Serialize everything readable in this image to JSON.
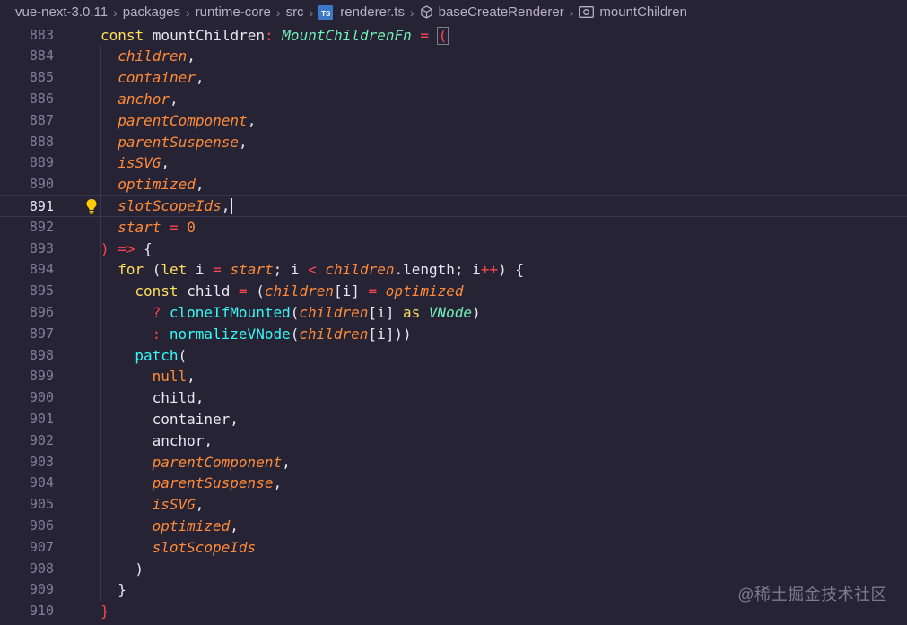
{
  "breadcrumb": {
    "items": [
      "vue-next-3.0.11",
      "packages",
      "runtime-core",
      "src",
      "renderer.ts",
      "baseCreateRenderer",
      "mountChildren"
    ],
    "ts_badge": "TS"
  },
  "colors": {
    "background": "#262335",
    "keyword": "#fede5d",
    "parameter": "#ff8b39",
    "type": "#72f1b8",
    "function": "#36f9f6",
    "plain": "#e8e6f0",
    "punct": "#fe4450",
    "line_number": "#837e9b"
  },
  "editor": {
    "current_line": 891,
    "lines": [
      {
        "n": "883",
        "indent": 0,
        "tokens": [
          [
            "const ",
            "kw"
          ],
          [
            "mountChildren",
            "var"
          ],
          [
            ": ",
            "op"
          ],
          [
            "MountChildrenFn",
            "type"
          ],
          [
            " = ",
            "op"
          ],
          [
            "(",
            "bracket"
          ]
        ]
      },
      {
        "n": "884",
        "indent": 1,
        "tokens": [
          [
            "children",
            "param"
          ],
          [
            ",",
            "punc"
          ]
        ]
      },
      {
        "n": "885",
        "indent": 1,
        "tokens": [
          [
            "container",
            "param"
          ],
          [
            ",",
            "punc"
          ]
        ]
      },
      {
        "n": "886",
        "indent": 1,
        "tokens": [
          [
            "anchor",
            "param"
          ],
          [
            ",",
            "punc"
          ]
        ]
      },
      {
        "n": "887",
        "indent": 1,
        "tokens": [
          [
            "parentComponent",
            "param"
          ],
          [
            ",",
            "punc"
          ]
        ]
      },
      {
        "n": "888",
        "indent": 1,
        "tokens": [
          [
            "parentSuspense",
            "param"
          ],
          [
            ",",
            "punc"
          ]
        ]
      },
      {
        "n": "889",
        "indent": 1,
        "tokens": [
          [
            "isSVG",
            "param"
          ],
          [
            ",",
            "punc"
          ]
        ]
      },
      {
        "n": "890",
        "indent": 1,
        "tokens": [
          [
            "optimized",
            "param"
          ],
          [
            ",",
            "punc"
          ]
        ]
      },
      {
        "n": "891",
        "indent": 1,
        "tokens": [
          [
            "slotScopeIds",
            "param"
          ],
          [
            ",",
            "punc"
          ]
        ]
      },
      {
        "n": "892",
        "indent": 1,
        "tokens": [
          [
            "start",
            "param"
          ],
          [
            " = ",
            "op"
          ],
          [
            "0",
            "num"
          ]
        ]
      },
      {
        "n": "893",
        "indent": 0,
        "tokens": [
          [
            ")",
            "bracket"
          ],
          [
            " => ",
            "op"
          ],
          [
            "{",
            "brace"
          ]
        ]
      },
      {
        "n": "894",
        "indent": 1,
        "tokens": [
          [
            "for ",
            "kw2"
          ],
          [
            "(",
            "brace"
          ],
          [
            "let ",
            "kw"
          ],
          [
            "i",
            "plain"
          ],
          [
            " = ",
            "op"
          ],
          [
            "start",
            "param"
          ],
          [
            "; ",
            "plain"
          ],
          [
            "i",
            "plain"
          ],
          [
            " < ",
            "op"
          ],
          [
            "children",
            "param"
          ],
          [
            ".length; ",
            "plain"
          ],
          [
            "i",
            "plain"
          ],
          [
            "++",
            "op"
          ],
          [
            ") ",
            "brace"
          ],
          [
            "{",
            "brace"
          ]
        ]
      },
      {
        "n": "895",
        "indent": 2,
        "tokens": [
          [
            "const ",
            "kw"
          ],
          [
            "child",
            "var"
          ],
          [
            " = ",
            "op"
          ],
          [
            "(",
            "brace"
          ],
          [
            "children",
            "param"
          ],
          [
            "[",
            "brace"
          ],
          [
            "i",
            "plain"
          ],
          [
            "]",
            "brace"
          ],
          [
            " = ",
            "op"
          ],
          [
            "optimized",
            "param"
          ]
        ]
      },
      {
        "n": "896",
        "indent": 3,
        "tokens": [
          [
            "? ",
            "op"
          ],
          [
            "cloneIfMounted",
            "fn"
          ],
          [
            "(",
            "brace"
          ],
          [
            "children",
            "param"
          ],
          [
            "[",
            "brace"
          ],
          [
            "i",
            "plain"
          ],
          [
            "] ",
            "brace"
          ],
          [
            "as ",
            "kw"
          ],
          [
            "VNode",
            "type"
          ],
          [
            ")",
            "brace"
          ]
        ]
      },
      {
        "n": "897",
        "indent": 3,
        "tokens": [
          [
            ": ",
            "op"
          ],
          [
            "normalizeVNode",
            "fn"
          ],
          [
            "(",
            "brace"
          ],
          [
            "children",
            "param"
          ],
          [
            "[",
            "brace"
          ],
          [
            "i",
            "plain"
          ],
          [
            "]))",
            "brace"
          ]
        ]
      },
      {
        "n": "898",
        "indent": 2,
        "tokens": [
          [
            "patch",
            "fn"
          ],
          [
            "(",
            "brace"
          ]
        ]
      },
      {
        "n": "899",
        "indent": 3,
        "tokens": [
          [
            "null",
            "lit"
          ],
          [
            ",",
            "punc"
          ]
        ]
      },
      {
        "n": "900",
        "indent": 3,
        "tokens": [
          [
            "child",
            "var"
          ],
          [
            ",",
            "punc"
          ]
        ]
      },
      {
        "n": "901",
        "indent": 3,
        "tokens": [
          [
            "container",
            "var"
          ],
          [
            ",",
            "punc"
          ]
        ]
      },
      {
        "n": "902",
        "indent": 3,
        "tokens": [
          [
            "anchor",
            "var"
          ],
          [
            ",",
            "punc"
          ]
        ]
      },
      {
        "n": "903",
        "indent": 3,
        "tokens": [
          [
            "parentComponent",
            "param"
          ],
          [
            ",",
            "punc"
          ]
        ]
      },
      {
        "n": "904",
        "indent": 3,
        "tokens": [
          [
            "parentSuspense",
            "param"
          ],
          [
            ",",
            "punc"
          ]
        ]
      },
      {
        "n": "905",
        "indent": 3,
        "tokens": [
          [
            "isSVG",
            "param"
          ],
          [
            ",",
            "punc"
          ]
        ]
      },
      {
        "n": "906",
        "indent": 3,
        "tokens": [
          [
            "optimized",
            "param"
          ],
          [
            ",",
            "punc"
          ]
        ]
      },
      {
        "n": "907",
        "indent": 3,
        "tokens": [
          [
            "slotScopeIds",
            "param"
          ]
        ]
      },
      {
        "n": "908",
        "indent": 2,
        "tokens": [
          [
            ")",
            "brace"
          ]
        ]
      },
      {
        "n": "909",
        "indent": 1,
        "tokens": [
          [
            "}",
            "brace"
          ]
        ]
      },
      {
        "n": "910",
        "indent": 0,
        "tokens": [
          [
            "}",
            "bracket"
          ]
        ]
      }
    ]
  },
  "watermark": "@稀土掘金技术社区"
}
